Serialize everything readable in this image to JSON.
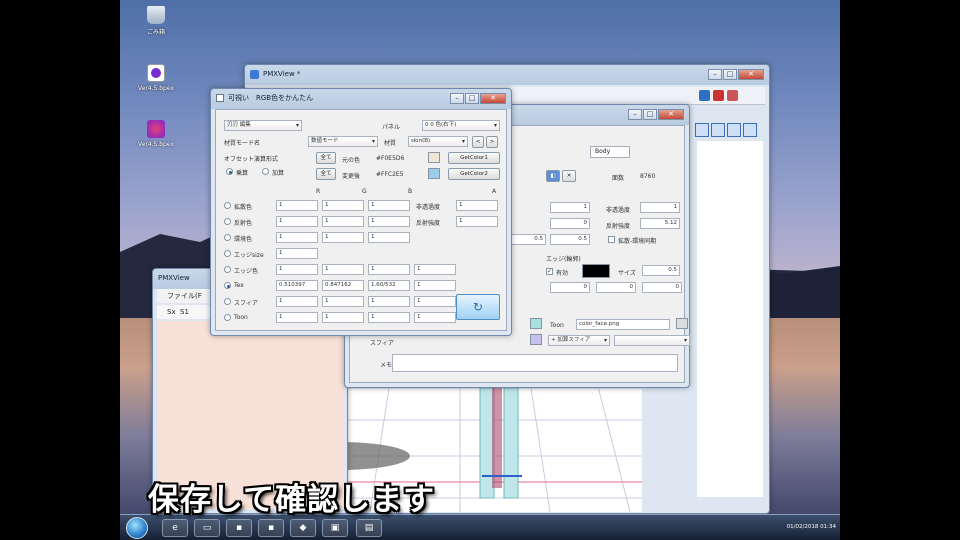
{
  "desktop": {
    "icons": [
      {
        "label": "ごみ箱",
        "icon": "recycle-bin-icon"
      },
      {
        "label": "Ver4.5.bpex",
        "icon": "file-icon"
      },
      {
        "label": "Ver4.5.bpex",
        "icon": "image-file-icon"
      }
    ]
  },
  "pmxview": {
    "title": "PMXView *"
  },
  "back_window": {
    "title": "PMXView",
    "menu": "ファイル(F",
    "labels": [
      "Sx",
      "S1"
    ]
  },
  "editor_window": {
    "tab": "Body",
    "fields": {
      "count_label": "面数",
      "count_value": "8760",
      "spec_power_label": "反射強度",
      "spec_power_value": "5.12",
      "trans_label": "非透過度",
      "edge_label": "エッジ(輪郭)",
      "edge_check": "有効",
      "size_label": "サイズ",
      "size_value": "0.5",
      "diffuse_check": "拡散-環境同期",
      "toon_label": "Toon",
      "toon_value": "color_face.png",
      "sphere_label": "スフィア",
      "sphere_select": "+ 加算スフィア",
      "memo_label": "メモ",
      "row_values": [
        "1",
        "0",
        "0.5",
        "0.5",
        "0",
        "0",
        "0",
        "1"
      ]
    }
  },
  "dialog": {
    "title": "可視い　RGB色をかんたん",
    "top_select": "刃刃  編集",
    "palette_label": "パネル",
    "palette_select": "0 0 色(右下)",
    "material_mode_label": "材質モード名",
    "material_mode_select": "数値モード",
    "material_label": "材質",
    "material_select": "skin(B)",
    "offset_label": "オフセット演算形式",
    "radio_multiply": "乗算",
    "radio_add": "加算",
    "all1": "全て",
    "all2": "全て",
    "src_color_label": "元の色",
    "src_color_value": "#F0E5D6",
    "src_color_hex": "#F0E5D6",
    "dst_color_label": "変更後",
    "dst_color_value": "#FFC2E5",
    "dst_color_hex": "#9CCDE8",
    "getcolor1": "GetColor1",
    "getcolor2": "GetColor2",
    "headers": [
      "R",
      "G",
      "B",
      "A"
    ],
    "rows": [
      {
        "label": "拡散色",
        "values": [
          "1",
          "1",
          "1"
        ],
        "extra_label": "非透過度",
        "extra_value": "1",
        "checked": false
      },
      {
        "label": "反射色",
        "values": [
          "1",
          "1",
          "1"
        ],
        "extra_label": "反射強度",
        "extra_value": "1",
        "checked": false
      },
      {
        "label": "環境色",
        "values": [
          "1",
          "1",
          "1"
        ],
        "extra_label": "",
        "extra_value": "",
        "checked": false
      },
      {
        "label": "エッジsize",
        "values": [
          "1"
        ],
        "extra_label": "",
        "extra_value": "",
        "checked": false
      },
      {
        "label": "エッジ色",
        "values": [
          "1",
          "1",
          "1",
          "1"
        ],
        "extra_label": "",
        "extra_value": "",
        "checked": false
      },
      {
        "label": "Tex",
        "values": [
          "0.510397",
          "0.847162",
          "1.60/532",
          "1"
        ],
        "extra_label": "",
        "extra_value": "",
        "checked": true
      },
      {
        "label": "スフィア",
        "values": [
          "1",
          "1",
          "1",
          "1"
        ],
        "extra_label": "",
        "extra_value": "",
        "checked": false
      },
      {
        "label": "Toon",
        "values": [
          "1",
          "1",
          "1",
          "1"
        ],
        "extra_label": "",
        "extra_value": "",
        "checked": false
      }
    ],
    "apply_icon": "apply-icon"
  },
  "taskbar": {
    "clock": "01/02/2018 01:34"
  },
  "subtitle": "保存して確認します"
}
